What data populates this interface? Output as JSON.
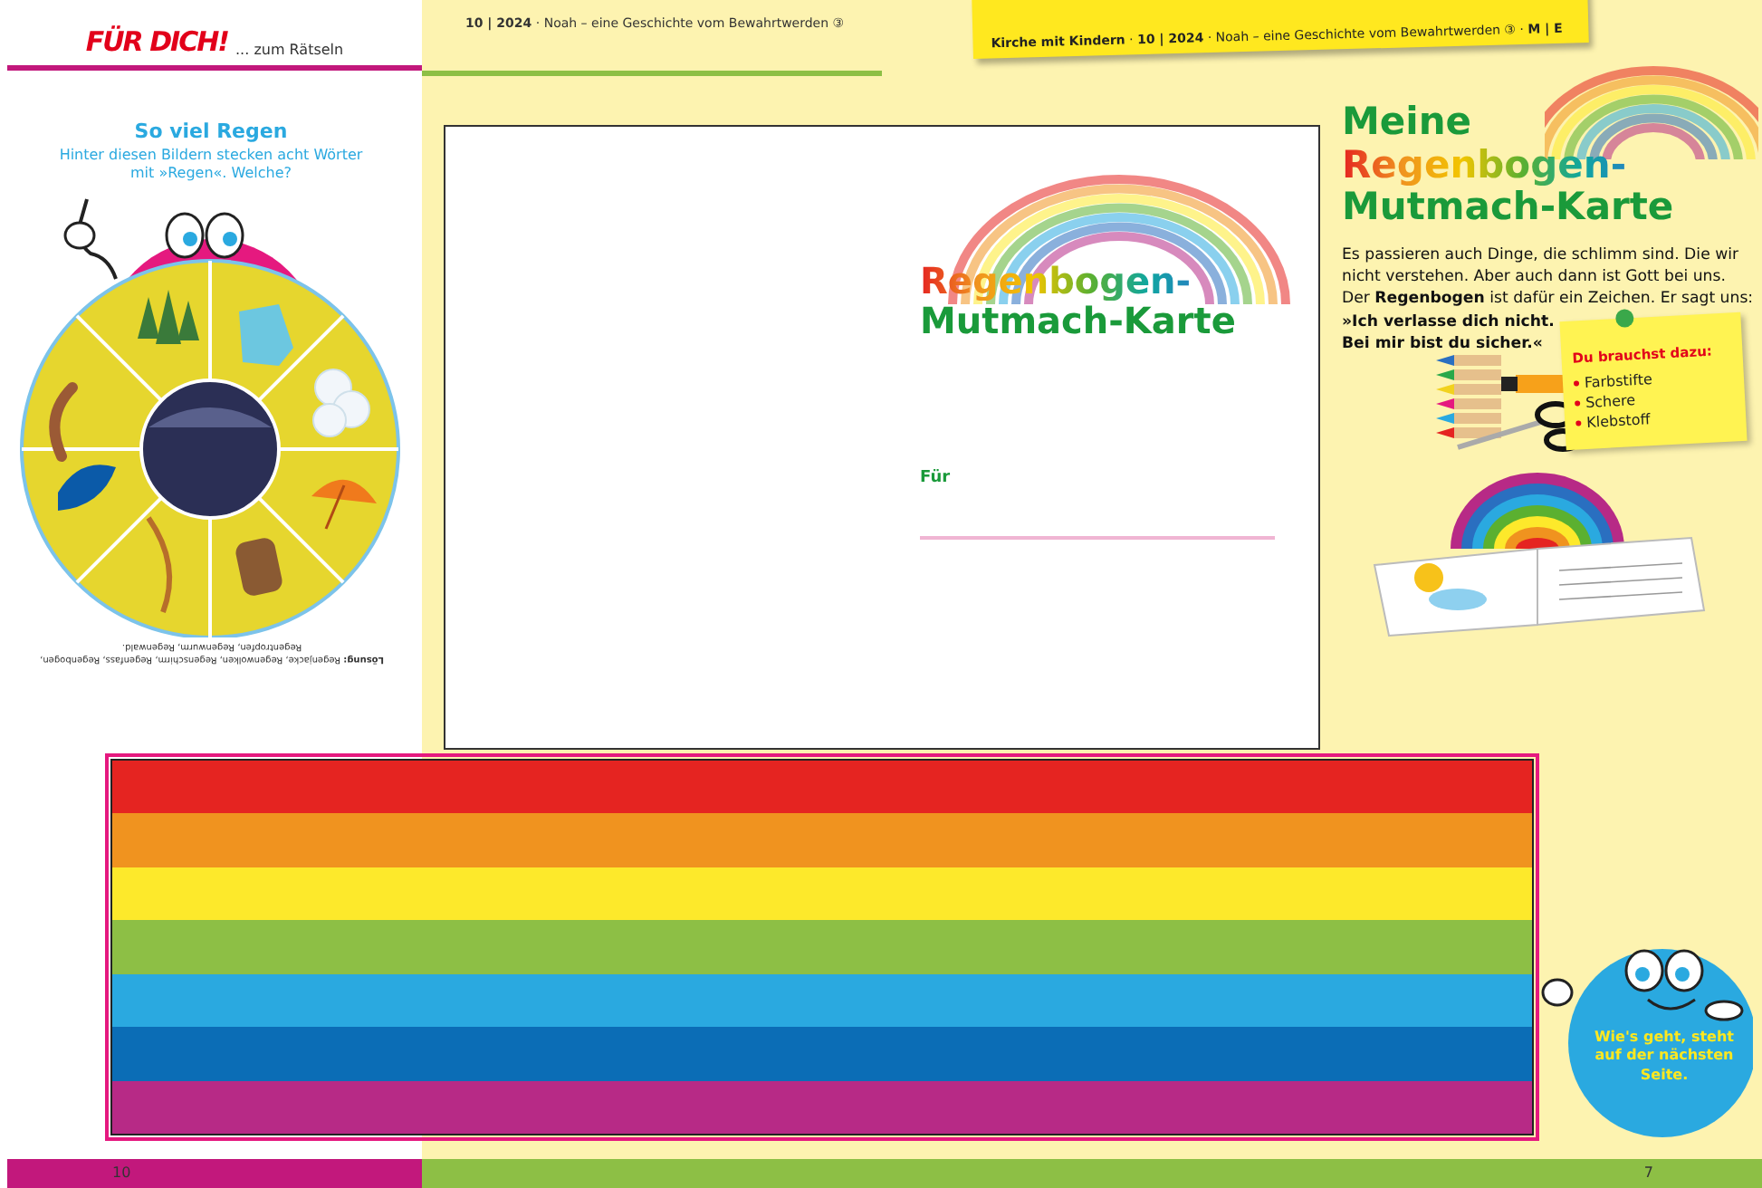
{
  "header": {
    "logo": "FÜR DICH!",
    "logo_tagline": "... zum Rätseln",
    "issue_line": "**10 | 2024** · Noah – eine Geschichte vom Bewahrtwerden ③",
    "sticky_line": "**Kirche mit Kindern** · **10 | 2024** · Noah – eine Geschichte vom Bewahrtwerden ③ · **M | E**"
  },
  "puzzle": {
    "title": "So viel Regen",
    "instruction": "Hinter diesen Bildern stecken acht Wörter mit »Regen«. Welche?",
    "solution": "**Lösung:** Regenjacke, Regenwolken, Regenschirm, Regenfass, Regenbogen, Regentropfen, Regenwurm, Regenwald."
  },
  "card": {
    "title_lines": [
      {
        "kind": "rainbow",
        "text": "Regenbogen-"
      },
      {
        "kind": "plain",
        "text": "Mutmach-Karte"
      }
    ],
    "for_label": "Für"
  },
  "info": {
    "title_lines": [
      {
        "kind": "plain",
        "text": "Meine"
      },
      {
        "kind": "rainbow",
        "text": "Regenbogen-"
      },
      {
        "kind": "plain",
        "text": "Mutmach-Karte"
      }
    ],
    "text": "Es passieren auch Dinge, die schlimm sind. Die wir nicht verstehen. Aber auch dann ist Gott bei uns. Der **Regenbogen** ist dafür ein Zeichen. Er sagt uns:",
    "quote": "»Ich verlasse dich nicht. Bei mir bist du sicher.«",
    "note_title": "Du brauchst dazu:",
    "note_items": [
      "Farbstifte",
      "Schere",
      "Klebstoff"
    ]
  },
  "stripes": [
    {
      "color": "#e52421"
    },
    {
      "color": "#f0931f"
    },
    {
      "color": "#fde92b"
    },
    {
      "color": "#8dbf45"
    },
    {
      "color": "#2aa9e0"
    },
    {
      "color": "#0b6db6"
    },
    {
      "color": "#b72a86"
    }
  ],
  "bubble": {
    "text": "Wie's geht, steht auf der nächsten Seite."
  },
  "footer": {
    "left_page": "10",
    "right_page": "7"
  }
}
